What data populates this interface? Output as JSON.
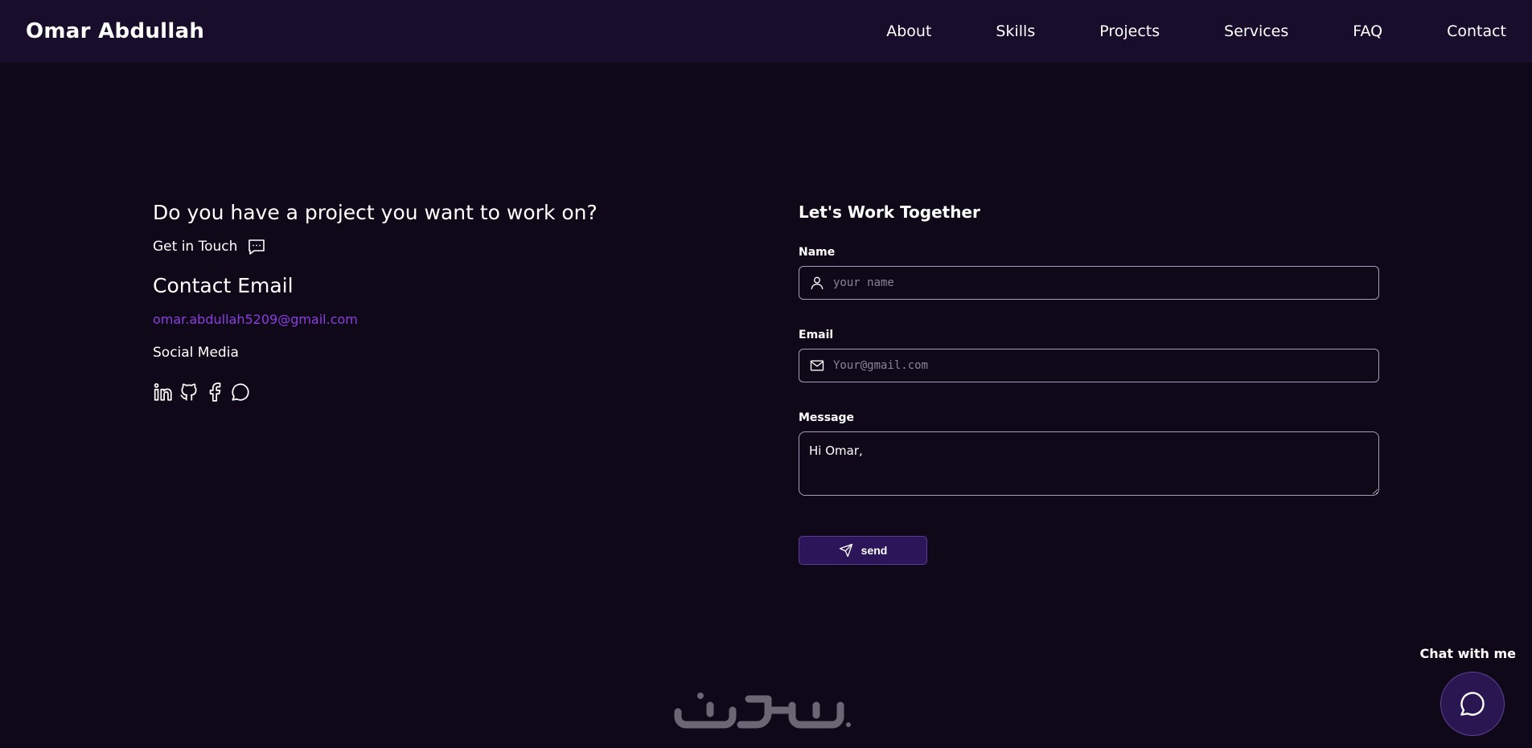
{
  "header": {
    "brand": "Omar Abdullah",
    "nav": [
      "About",
      "Skills",
      "Projects",
      "Services",
      "FAQ",
      "Contact"
    ]
  },
  "contact": {
    "question": "Do you have a project you want to work on?",
    "get_in_touch": "Get in Touch",
    "email_title": "Contact Email",
    "email": "omar.abdullah5209@gmail.com",
    "social_title": "Social Media",
    "social_icons": [
      "linkedin-icon",
      "github-icon",
      "facebook-icon",
      "whatsapp-icon"
    ]
  },
  "form": {
    "title": "Let's Work Together",
    "name_label": "Name",
    "name_placeholder": "your name",
    "email_label": "Email",
    "email_placeholder": "Your@gmail.com",
    "message_label": "Message",
    "message_value": "Hi Omar,",
    "send_label": "send"
  },
  "chat": {
    "label": "Chat with me"
  },
  "colors": {
    "background": "#0e0818",
    "header": "#190d2c",
    "accent": "#8b3fe0",
    "button": "#2c1558"
  }
}
